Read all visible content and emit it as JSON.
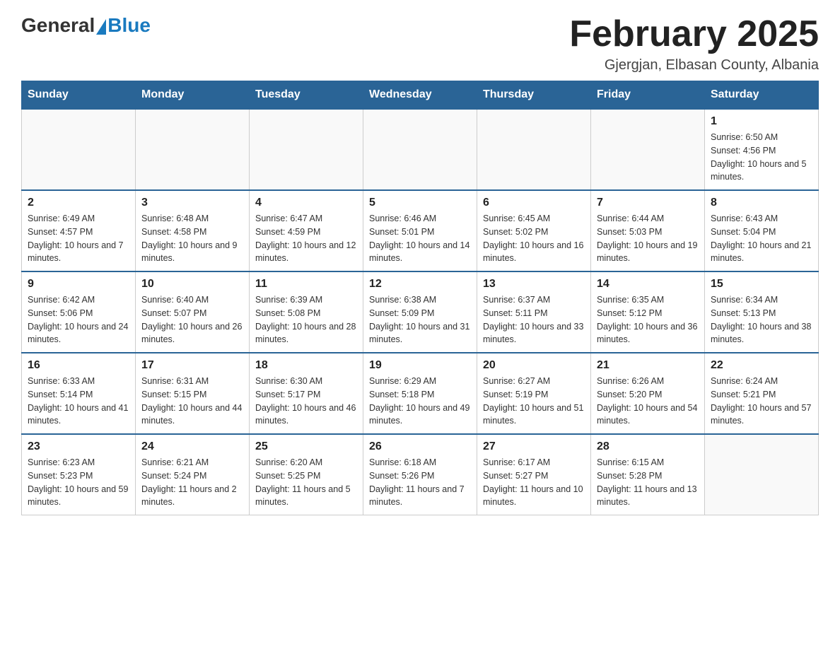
{
  "header": {
    "logo_general": "General",
    "logo_blue": "Blue",
    "title": "February 2025",
    "subtitle": "Gjergjan, Elbasan County, Albania"
  },
  "days_of_week": [
    "Sunday",
    "Monday",
    "Tuesday",
    "Wednesday",
    "Thursday",
    "Friday",
    "Saturday"
  ],
  "weeks": [
    [
      {
        "day": "",
        "sunrise": "",
        "sunset": "",
        "daylight": ""
      },
      {
        "day": "",
        "sunrise": "",
        "sunset": "",
        "daylight": ""
      },
      {
        "day": "",
        "sunrise": "",
        "sunset": "",
        "daylight": ""
      },
      {
        "day": "",
        "sunrise": "",
        "sunset": "",
        "daylight": ""
      },
      {
        "day": "",
        "sunrise": "",
        "sunset": "",
        "daylight": ""
      },
      {
        "day": "",
        "sunrise": "",
        "sunset": "",
        "daylight": ""
      },
      {
        "day": "1",
        "sunrise": "Sunrise: 6:50 AM",
        "sunset": "Sunset: 4:56 PM",
        "daylight": "Daylight: 10 hours and 5 minutes."
      }
    ],
    [
      {
        "day": "2",
        "sunrise": "Sunrise: 6:49 AM",
        "sunset": "Sunset: 4:57 PM",
        "daylight": "Daylight: 10 hours and 7 minutes."
      },
      {
        "day": "3",
        "sunrise": "Sunrise: 6:48 AM",
        "sunset": "Sunset: 4:58 PM",
        "daylight": "Daylight: 10 hours and 9 minutes."
      },
      {
        "day": "4",
        "sunrise": "Sunrise: 6:47 AM",
        "sunset": "Sunset: 4:59 PM",
        "daylight": "Daylight: 10 hours and 12 minutes."
      },
      {
        "day": "5",
        "sunrise": "Sunrise: 6:46 AM",
        "sunset": "Sunset: 5:01 PM",
        "daylight": "Daylight: 10 hours and 14 minutes."
      },
      {
        "day": "6",
        "sunrise": "Sunrise: 6:45 AM",
        "sunset": "Sunset: 5:02 PM",
        "daylight": "Daylight: 10 hours and 16 minutes."
      },
      {
        "day": "7",
        "sunrise": "Sunrise: 6:44 AM",
        "sunset": "Sunset: 5:03 PM",
        "daylight": "Daylight: 10 hours and 19 minutes."
      },
      {
        "day": "8",
        "sunrise": "Sunrise: 6:43 AM",
        "sunset": "Sunset: 5:04 PM",
        "daylight": "Daylight: 10 hours and 21 minutes."
      }
    ],
    [
      {
        "day": "9",
        "sunrise": "Sunrise: 6:42 AM",
        "sunset": "Sunset: 5:06 PM",
        "daylight": "Daylight: 10 hours and 24 minutes."
      },
      {
        "day": "10",
        "sunrise": "Sunrise: 6:40 AM",
        "sunset": "Sunset: 5:07 PM",
        "daylight": "Daylight: 10 hours and 26 minutes."
      },
      {
        "day": "11",
        "sunrise": "Sunrise: 6:39 AM",
        "sunset": "Sunset: 5:08 PM",
        "daylight": "Daylight: 10 hours and 28 minutes."
      },
      {
        "day": "12",
        "sunrise": "Sunrise: 6:38 AM",
        "sunset": "Sunset: 5:09 PM",
        "daylight": "Daylight: 10 hours and 31 minutes."
      },
      {
        "day": "13",
        "sunrise": "Sunrise: 6:37 AM",
        "sunset": "Sunset: 5:11 PM",
        "daylight": "Daylight: 10 hours and 33 minutes."
      },
      {
        "day": "14",
        "sunrise": "Sunrise: 6:35 AM",
        "sunset": "Sunset: 5:12 PM",
        "daylight": "Daylight: 10 hours and 36 minutes."
      },
      {
        "day": "15",
        "sunrise": "Sunrise: 6:34 AM",
        "sunset": "Sunset: 5:13 PM",
        "daylight": "Daylight: 10 hours and 38 minutes."
      }
    ],
    [
      {
        "day": "16",
        "sunrise": "Sunrise: 6:33 AM",
        "sunset": "Sunset: 5:14 PM",
        "daylight": "Daylight: 10 hours and 41 minutes."
      },
      {
        "day": "17",
        "sunrise": "Sunrise: 6:31 AM",
        "sunset": "Sunset: 5:15 PM",
        "daylight": "Daylight: 10 hours and 44 minutes."
      },
      {
        "day": "18",
        "sunrise": "Sunrise: 6:30 AM",
        "sunset": "Sunset: 5:17 PM",
        "daylight": "Daylight: 10 hours and 46 minutes."
      },
      {
        "day": "19",
        "sunrise": "Sunrise: 6:29 AM",
        "sunset": "Sunset: 5:18 PM",
        "daylight": "Daylight: 10 hours and 49 minutes."
      },
      {
        "day": "20",
        "sunrise": "Sunrise: 6:27 AM",
        "sunset": "Sunset: 5:19 PM",
        "daylight": "Daylight: 10 hours and 51 minutes."
      },
      {
        "day": "21",
        "sunrise": "Sunrise: 6:26 AM",
        "sunset": "Sunset: 5:20 PM",
        "daylight": "Daylight: 10 hours and 54 minutes."
      },
      {
        "day": "22",
        "sunrise": "Sunrise: 6:24 AM",
        "sunset": "Sunset: 5:21 PM",
        "daylight": "Daylight: 10 hours and 57 minutes."
      }
    ],
    [
      {
        "day": "23",
        "sunrise": "Sunrise: 6:23 AM",
        "sunset": "Sunset: 5:23 PM",
        "daylight": "Daylight: 10 hours and 59 minutes."
      },
      {
        "day": "24",
        "sunrise": "Sunrise: 6:21 AM",
        "sunset": "Sunset: 5:24 PM",
        "daylight": "Daylight: 11 hours and 2 minutes."
      },
      {
        "day": "25",
        "sunrise": "Sunrise: 6:20 AM",
        "sunset": "Sunset: 5:25 PM",
        "daylight": "Daylight: 11 hours and 5 minutes."
      },
      {
        "day": "26",
        "sunrise": "Sunrise: 6:18 AM",
        "sunset": "Sunset: 5:26 PM",
        "daylight": "Daylight: 11 hours and 7 minutes."
      },
      {
        "day": "27",
        "sunrise": "Sunrise: 6:17 AM",
        "sunset": "Sunset: 5:27 PM",
        "daylight": "Daylight: 11 hours and 10 minutes."
      },
      {
        "day": "28",
        "sunrise": "Sunrise: 6:15 AM",
        "sunset": "Sunset: 5:28 PM",
        "daylight": "Daylight: 11 hours and 13 minutes."
      },
      {
        "day": "",
        "sunrise": "",
        "sunset": "",
        "daylight": ""
      }
    ]
  ]
}
